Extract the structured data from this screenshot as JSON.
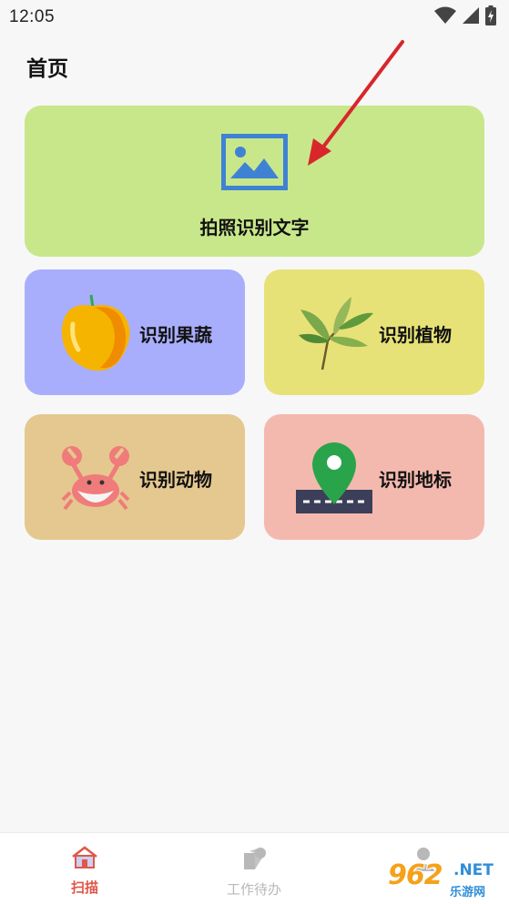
{
  "status_bar": {
    "time": "12:05",
    "icons": [
      "wifi-icon",
      "signal-icon",
      "battery-charging-icon"
    ]
  },
  "header": {
    "title": "首页"
  },
  "main": {
    "photo_card": {
      "label": "拍照识别文字",
      "icon": "image-icon",
      "accent": "#3f82d4"
    },
    "tiles": [
      {
        "label": "识别果蔬",
        "icon": "fruit-icon",
        "color": "#a9aefc"
      },
      {
        "label": "识别植物",
        "icon": "plant-icon",
        "color": "#e7e277"
      },
      {
        "label": "识别动物",
        "icon": "crab-icon",
        "color": "#e5c88f"
      },
      {
        "label": "识别地标",
        "icon": "location-pin-icon",
        "color": "#f4b9ae"
      }
    ]
  },
  "bottom_nav": {
    "items": [
      {
        "label": "扫描",
        "icon": "home-icon",
        "active": true
      },
      {
        "label": "工作待办",
        "icon": "todo-icon",
        "active": false
      },
      {
        "label": "",
        "icon": "user-icon",
        "active": false
      }
    ]
  },
  "watermark": {
    "logo": "962",
    "suffix": ".NET",
    "sub": "乐游网"
  },
  "colors": {
    "active_nav": "#e0574a",
    "inactive_nav": "#b8b8b8",
    "background": "#f7f7f8"
  }
}
